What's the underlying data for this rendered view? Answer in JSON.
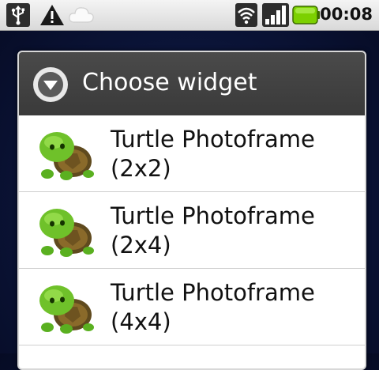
{
  "status_bar": {
    "icons": [
      "usb-icon",
      "warning-icon",
      "cloud-icon",
      "wifi-icon",
      "signal-icon",
      "battery-icon"
    ],
    "time": "00:08"
  },
  "dialog": {
    "title": "Choose widget",
    "items": [
      {
        "label": "Turtle Photoframe\n(2x2)"
      },
      {
        "label": "Turtle Photoframe\n(2x4)"
      },
      {
        "label": "Turtle Photoframe\n(4x4)"
      }
    ]
  },
  "colors": {
    "title_bar": "#3f3f3f",
    "battery": "#7cd000",
    "background": "#0b1438"
  }
}
